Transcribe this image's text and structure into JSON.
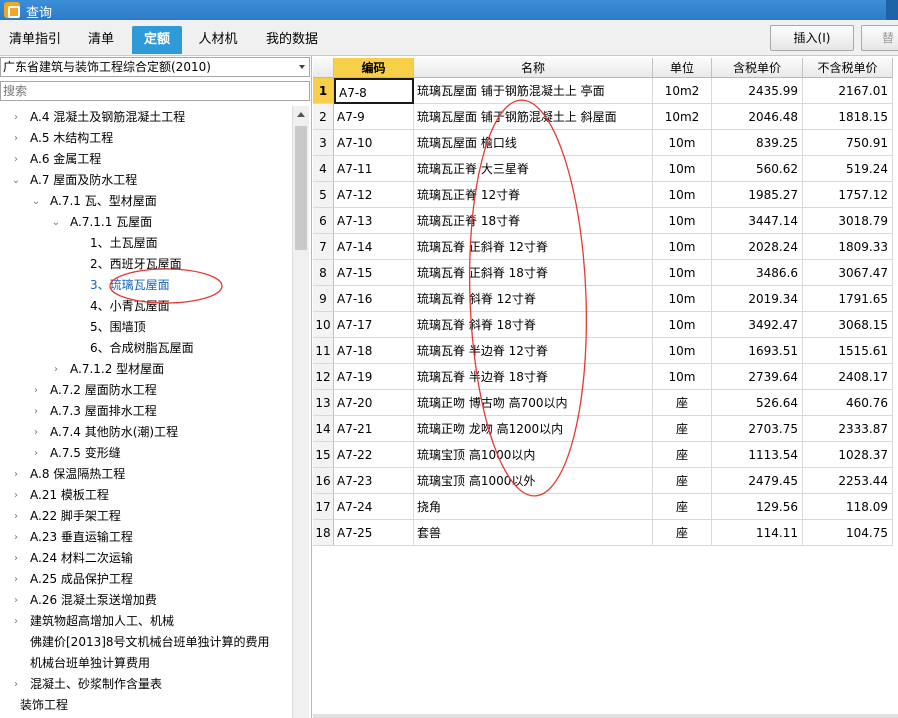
{
  "window": {
    "title": "查询"
  },
  "tabs": [
    {
      "label": "清单指引",
      "active": false
    },
    {
      "label": "清单",
      "active": false
    },
    {
      "label": "定额",
      "active": true
    },
    {
      "label": "人材机",
      "active": false
    },
    {
      "label": "我的数据",
      "active": false
    }
  ],
  "toolbar": {
    "insert_label": "插入(I)",
    "replace_label": "替"
  },
  "left": {
    "quota_library": "广东省建筑与装饰工程综合定额(2010)",
    "search_placeholder": "搜索",
    "tree": [
      {
        "label": "A.4 混凝土及钢筋混凝土工程",
        "expander": "›",
        "level": 1
      },
      {
        "label": "A.5 木结构工程",
        "expander": "›",
        "level": 1
      },
      {
        "label": "A.6 金属工程",
        "expander": "›",
        "level": 1
      },
      {
        "label": "A.7 屋面及防水工程",
        "expander": "⌄",
        "level": 1
      },
      {
        "label": "A.7.1 瓦、型材屋面",
        "expander": "⌄",
        "level": 2
      },
      {
        "label": "A.7.1.1 瓦屋面",
        "expander": "⌄",
        "level": 3
      },
      {
        "label": "1、土瓦屋面",
        "expander": "",
        "level": 4
      },
      {
        "label": "2、西班牙瓦屋面",
        "expander": "",
        "level": 4
      },
      {
        "label": "3、琉璃瓦屋面",
        "expander": "",
        "level": 4,
        "selected": true
      },
      {
        "label": "4、小青瓦屋面",
        "expander": "",
        "level": 4
      },
      {
        "label": "5、围墙顶",
        "expander": "",
        "level": 4
      },
      {
        "label": "6、合成树脂瓦屋面",
        "expander": "",
        "level": 4
      },
      {
        "label": "A.7.1.2 型材屋面",
        "expander": "›",
        "level": 3
      },
      {
        "label": "A.7.2 屋面防水工程",
        "expander": "›",
        "level": 2
      },
      {
        "label": "A.7.3 屋面排水工程",
        "expander": "›",
        "level": 2
      },
      {
        "label": "A.7.4 其他防水(潮)工程",
        "expander": "›",
        "level": 2
      },
      {
        "label": "A.7.5 变形缝",
        "expander": "›",
        "level": 2
      },
      {
        "label": "A.8 保温隔热工程",
        "expander": "›",
        "level": 1
      },
      {
        "label": "A.21 模板工程",
        "expander": "›",
        "level": 1
      },
      {
        "label": "A.22 脚手架工程",
        "expander": "›",
        "level": 1
      },
      {
        "label": "A.23 垂直运输工程",
        "expander": "›",
        "level": 1
      },
      {
        "label": "A.24 材料二次运输",
        "expander": "›",
        "level": 1
      },
      {
        "label": "A.25 成品保护工程",
        "expander": "›",
        "level": 1
      },
      {
        "label": "A.26 混凝土泵送增加费",
        "expander": "›",
        "level": 1
      },
      {
        "label": "建筑物超高增加人工、机械",
        "expander": "›",
        "level": 1
      },
      {
        "label": "佛建价[2013]8号文机械台班单独计算的费用",
        "expander": "",
        "level": 1
      },
      {
        "label": "机械台班单独计算费用",
        "expander": "",
        "level": 1
      },
      {
        "label": "混凝土、砂浆制作含量表",
        "expander": "›",
        "level": 1
      },
      {
        "label": "装饰工程",
        "expander": "›",
        "level": 0
      }
    ]
  },
  "grid": {
    "headers": {
      "code": "编码",
      "name": "名称",
      "unit": "单位",
      "tax_price": "含税单价",
      "notax_price": "不含税单价"
    },
    "rows": [
      {
        "no": "1",
        "code": "A7-8",
        "name": "琉璃瓦屋面 铺于钢筋混凝土上 亭面",
        "unit": "10m2",
        "tax_price": "2435.99",
        "notax_price": "2167.01"
      },
      {
        "no": "2",
        "code": "A7-9",
        "name": "琉璃瓦屋面 铺于钢筋混凝土上 斜屋面",
        "unit": "10m2",
        "tax_price": "2046.48",
        "notax_price": "1818.15"
      },
      {
        "no": "3",
        "code": "A7-10",
        "name": "琉璃瓦屋面 檐口线",
        "unit": "10m",
        "tax_price": "839.25",
        "notax_price": "750.91"
      },
      {
        "no": "4",
        "code": "A7-11",
        "name": "琉璃瓦正脊 大三星脊",
        "unit": "10m",
        "tax_price": "560.62",
        "notax_price": "519.24"
      },
      {
        "no": "5",
        "code": "A7-12",
        "name": "琉璃瓦正脊 12寸脊",
        "unit": "10m",
        "tax_price": "1985.27",
        "notax_price": "1757.12"
      },
      {
        "no": "6",
        "code": "A7-13",
        "name": "琉璃瓦正脊 18寸脊",
        "unit": "10m",
        "tax_price": "3447.14",
        "notax_price": "3018.79"
      },
      {
        "no": "7",
        "code": "A7-14",
        "name": "琉璃瓦脊 正斜脊 12寸脊",
        "unit": "10m",
        "tax_price": "2028.24",
        "notax_price": "1809.33"
      },
      {
        "no": "8",
        "code": "A7-15",
        "name": "琉璃瓦脊 正斜脊 18寸脊",
        "unit": "10m",
        "tax_price": "3486.6",
        "notax_price": "3067.47"
      },
      {
        "no": "9",
        "code": "A7-16",
        "name": "琉璃瓦脊 斜脊 12寸脊",
        "unit": "10m",
        "tax_price": "2019.34",
        "notax_price": "1791.65"
      },
      {
        "no": "10",
        "code": "A7-17",
        "name": "琉璃瓦脊 斜脊 18寸脊",
        "unit": "10m",
        "tax_price": "3492.47",
        "notax_price": "3068.15"
      },
      {
        "no": "11",
        "code": "A7-18",
        "name": "琉璃瓦脊 半边脊 12寸脊",
        "unit": "10m",
        "tax_price": "1693.51",
        "notax_price": "1515.61"
      },
      {
        "no": "12",
        "code": "A7-19",
        "name": "琉璃瓦脊 半边脊 18寸脊",
        "unit": "10m",
        "tax_price": "2739.64",
        "notax_price": "2408.17"
      },
      {
        "no": "13",
        "code": "A7-20",
        "name": "琉璃正吻 博古吻 高700以内",
        "unit": "座",
        "tax_price": "526.64",
        "notax_price": "460.76"
      },
      {
        "no": "14",
        "code": "A7-21",
        "name": "琉璃正吻 龙吻 高1200以内",
        "unit": "座",
        "tax_price": "2703.75",
        "notax_price": "2333.87"
      },
      {
        "no": "15",
        "code": "A7-22",
        "name": "琉璃宝顶 高1000以内",
        "unit": "座",
        "tax_price": "1113.54",
        "notax_price": "1028.37"
      },
      {
        "no": "16",
        "code": "A7-23",
        "name": "琉璃宝顶 高1000以外",
        "unit": "座",
        "tax_price": "2479.45",
        "notax_price": "2253.44"
      },
      {
        "no": "17",
        "code": "A7-24",
        "name": "挠角",
        "unit": "座",
        "tax_price": "129.56",
        "notax_price": "118.09"
      },
      {
        "no": "18",
        "code": "A7-25",
        "name": "套兽",
        "unit": "座",
        "tax_price": "114.11",
        "notax_price": "104.75"
      }
    ]
  },
  "colors": {
    "accent": "#2e9bd8",
    "header_highlight": "#f7cf49",
    "annotation": "#e53935"
  }
}
